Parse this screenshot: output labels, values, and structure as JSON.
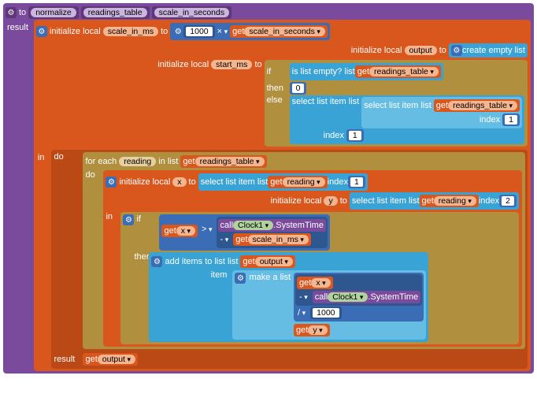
{
  "proc": {
    "to": "to",
    "name": "normalize",
    "arg1": "readings_table",
    "arg2": "scale_in_seconds",
    "result": "result"
  },
  "init": {
    "label": "initialize local",
    "scale_ms_var": "scale_in_ms",
    "to": "to",
    "output_var": "output",
    "start_ms_var": "start_ms"
  },
  "math": {
    "mult_left": "1000",
    "times": "×",
    "gt": ">",
    "minus": "-",
    "div": "/",
    "thousand": "1000"
  },
  "get": {
    "kw": "get"
  },
  "vars": {
    "scale_in_seconds": "scale_in_seconds",
    "readings_table": "readings_table",
    "reading": "reading",
    "output": "output",
    "scale_in_ms": "scale_in_ms",
    "x": "x",
    "y": "y"
  },
  "list": {
    "create_empty": "create empty list",
    "is_empty": "is list empty?  list",
    "select_item": "select list item  list",
    "index": "index",
    "add_items": "add items to list   list",
    "item": "item",
    "make_a_list": "make a list"
  },
  "control": {
    "if": "if",
    "then": "then",
    "else": "else",
    "in": "in",
    "do": "do",
    "result_kw": "result",
    "for_each": "for each",
    "in_list": "in list"
  },
  "nums": {
    "zero": "0",
    "one": "1",
    "two": "2"
  },
  "clock": {
    "call": "call",
    "comp": "Clock1",
    "method": ".SystemTime"
  },
  "gear_glyph": "⚙"
}
